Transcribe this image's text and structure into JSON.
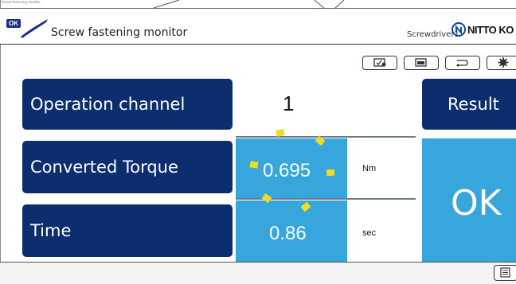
{
  "header": {
    "tiny_caption": "Screw fastening monitor",
    "badge": "OK",
    "title": "Screw fastening monitor",
    "device": "Screwdriver1",
    "brand": "NITTO KO"
  },
  "toolbar": {
    "icons": [
      "settings-screen-icon",
      "monitor-icon",
      "connection-icon",
      "gear-icon"
    ]
  },
  "rows": {
    "channel": {
      "label": "Operation channel",
      "value": "1"
    },
    "torque": {
      "label": "Converted Torque",
      "value": "0.695",
      "unit": "Nm"
    },
    "time": {
      "label": "Time",
      "value": "0.86",
      "unit": "sec"
    }
  },
  "result": {
    "label": "Result",
    "value": "OK"
  },
  "colors": {
    "label_tile": "#0d2e6e",
    "value_cell": "#37a6dc",
    "loading_dash": "#f2dc1f"
  }
}
